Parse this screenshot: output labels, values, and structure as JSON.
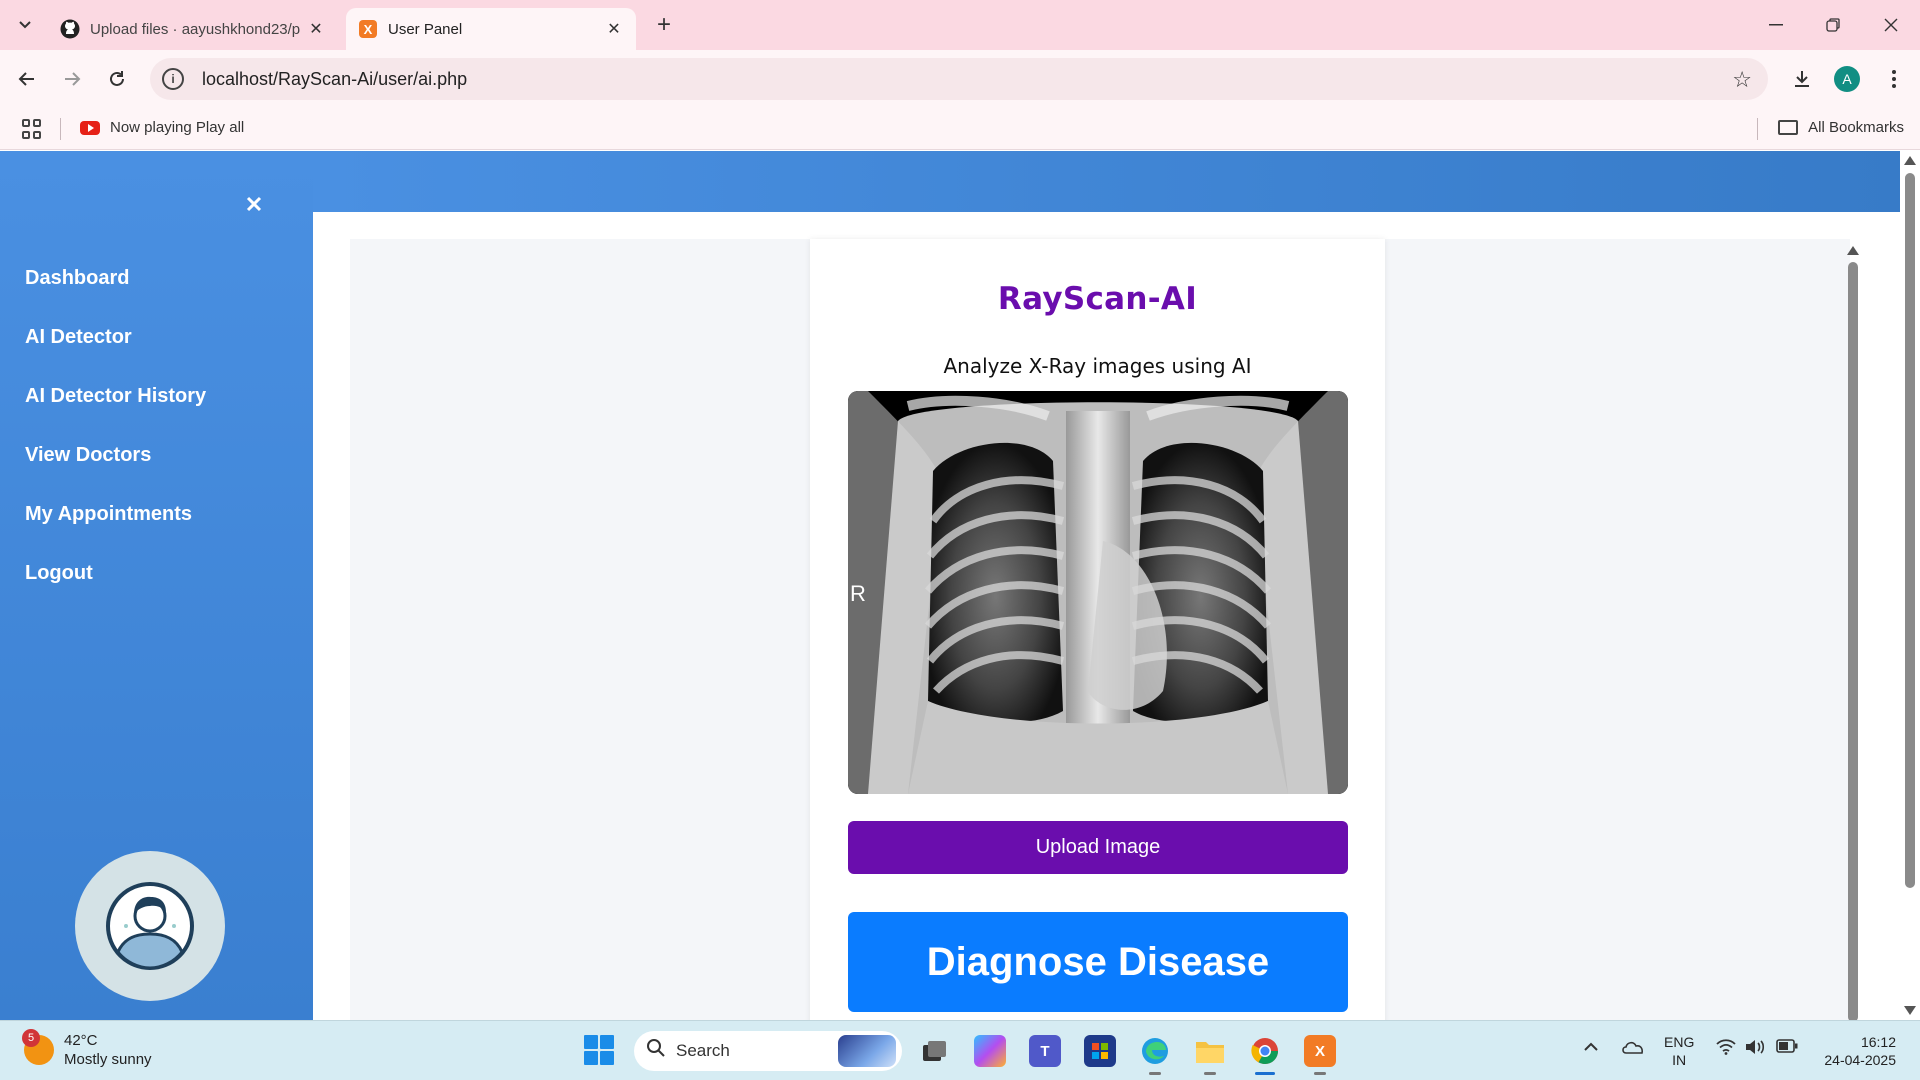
{
  "browser": {
    "tabs": [
      {
        "title": "Upload files · aayushkhond23/p",
        "active": false,
        "icon": "github-icon"
      },
      {
        "title": "User Panel",
        "active": true,
        "icon": "xampp-icon"
      }
    ],
    "url": "localhost/RayScan-Ai/user/ai.php",
    "profile_initial": "A",
    "bookmarks": {
      "item": "Now playing Play all",
      "all_bookmarks": "All Bookmarks"
    }
  },
  "sidebar": {
    "items": [
      {
        "label": "Dashboard"
      },
      {
        "label": "AI Detector"
      },
      {
        "label": "AI Detector History"
      },
      {
        "label": "View Doctors"
      },
      {
        "label": "My Appointments"
      },
      {
        "label": "Logout"
      }
    ]
  },
  "panel": {
    "title": "RayScan-AI",
    "subtitle": "Analyze X-Ray images using AI",
    "xray_marker": "R",
    "upload_label": "Upload Image",
    "diagnose_label": "Diagnose Disease"
  },
  "taskbar": {
    "weather_temp": "42°C",
    "weather_desc": "Mostly sunny",
    "weather_badge": "5",
    "search_label": "Search",
    "language": "ENG",
    "region": "IN",
    "time": "16:12",
    "date": "24-04-2025"
  },
  "colors": {
    "sidebar": "#4a90e2",
    "title_purple": "#6a0dad",
    "upload_button": "#6a0dad",
    "diagnose_button": "#0a7cff"
  }
}
